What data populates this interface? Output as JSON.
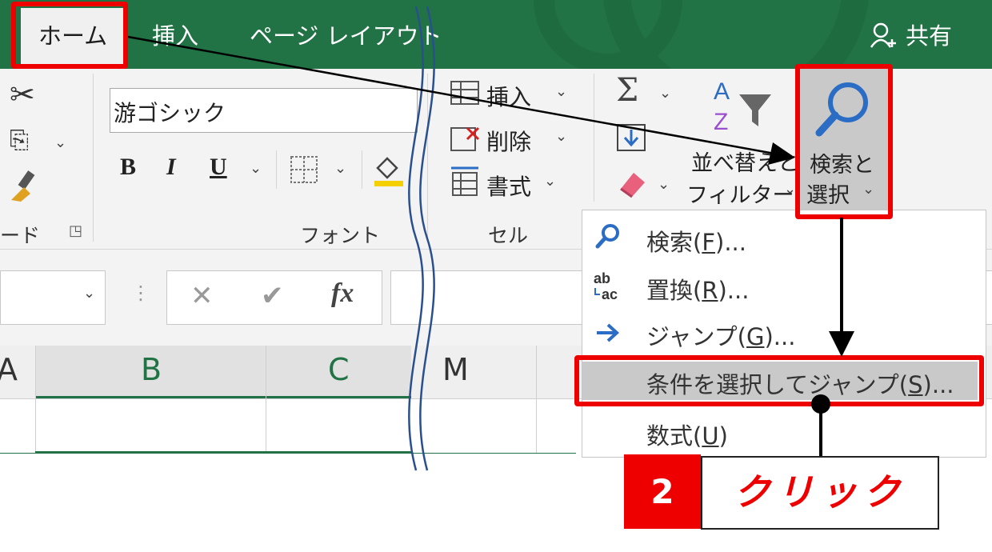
{
  "tabs": {
    "home": "ホーム",
    "insert": "挿入",
    "page_layout": "ページ レイアウト",
    "share": "共有"
  },
  "ribbon": {
    "font_name": "游ゴシック",
    "bold": "B",
    "italic": "I",
    "underline": "U",
    "cells": {
      "insert": "挿入",
      "delete": "削除",
      "format": "書式"
    },
    "sort_filter_line1": "並べ替えと",
    "sort_filter_line2": "フィルター",
    "find_select_line1": "検索と",
    "find_select_line2": "選択",
    "group_clipboard": "ード",
    "group_font": "フォント",
    "group_cells": "セル"
  },
  "formula_bar": {
    "fx": "fx"
  },
  "columns": [
    "A",
    "B",
    "C",
    "M"
  ],
  "menu": {
    "find": {
      "text": "検索(",
      "key": "F",
      "end": ")..."
    },
    "replace": {
      "text": "置換(",
      "key": "R",
      "end": ")..."
    },
    "goto": {
      "text": "ジャンプ(",
      "key": "G",
      "end": ")..."
    },
    "goto_special": {
      "text": "条件を選択してジャンプ(",
      "key": "S",
      "end": ")..."
    },
    "formulas": {
      "text": "数式(",
      "key": "U",
      "end": ")"
    }
  },
  "callout": {
    "number": "2",
    "label": "クリック"
  },
  "colors": {
    "excel_green": "#217346",
    "highlight_red": "#ee0000"
  }
}
